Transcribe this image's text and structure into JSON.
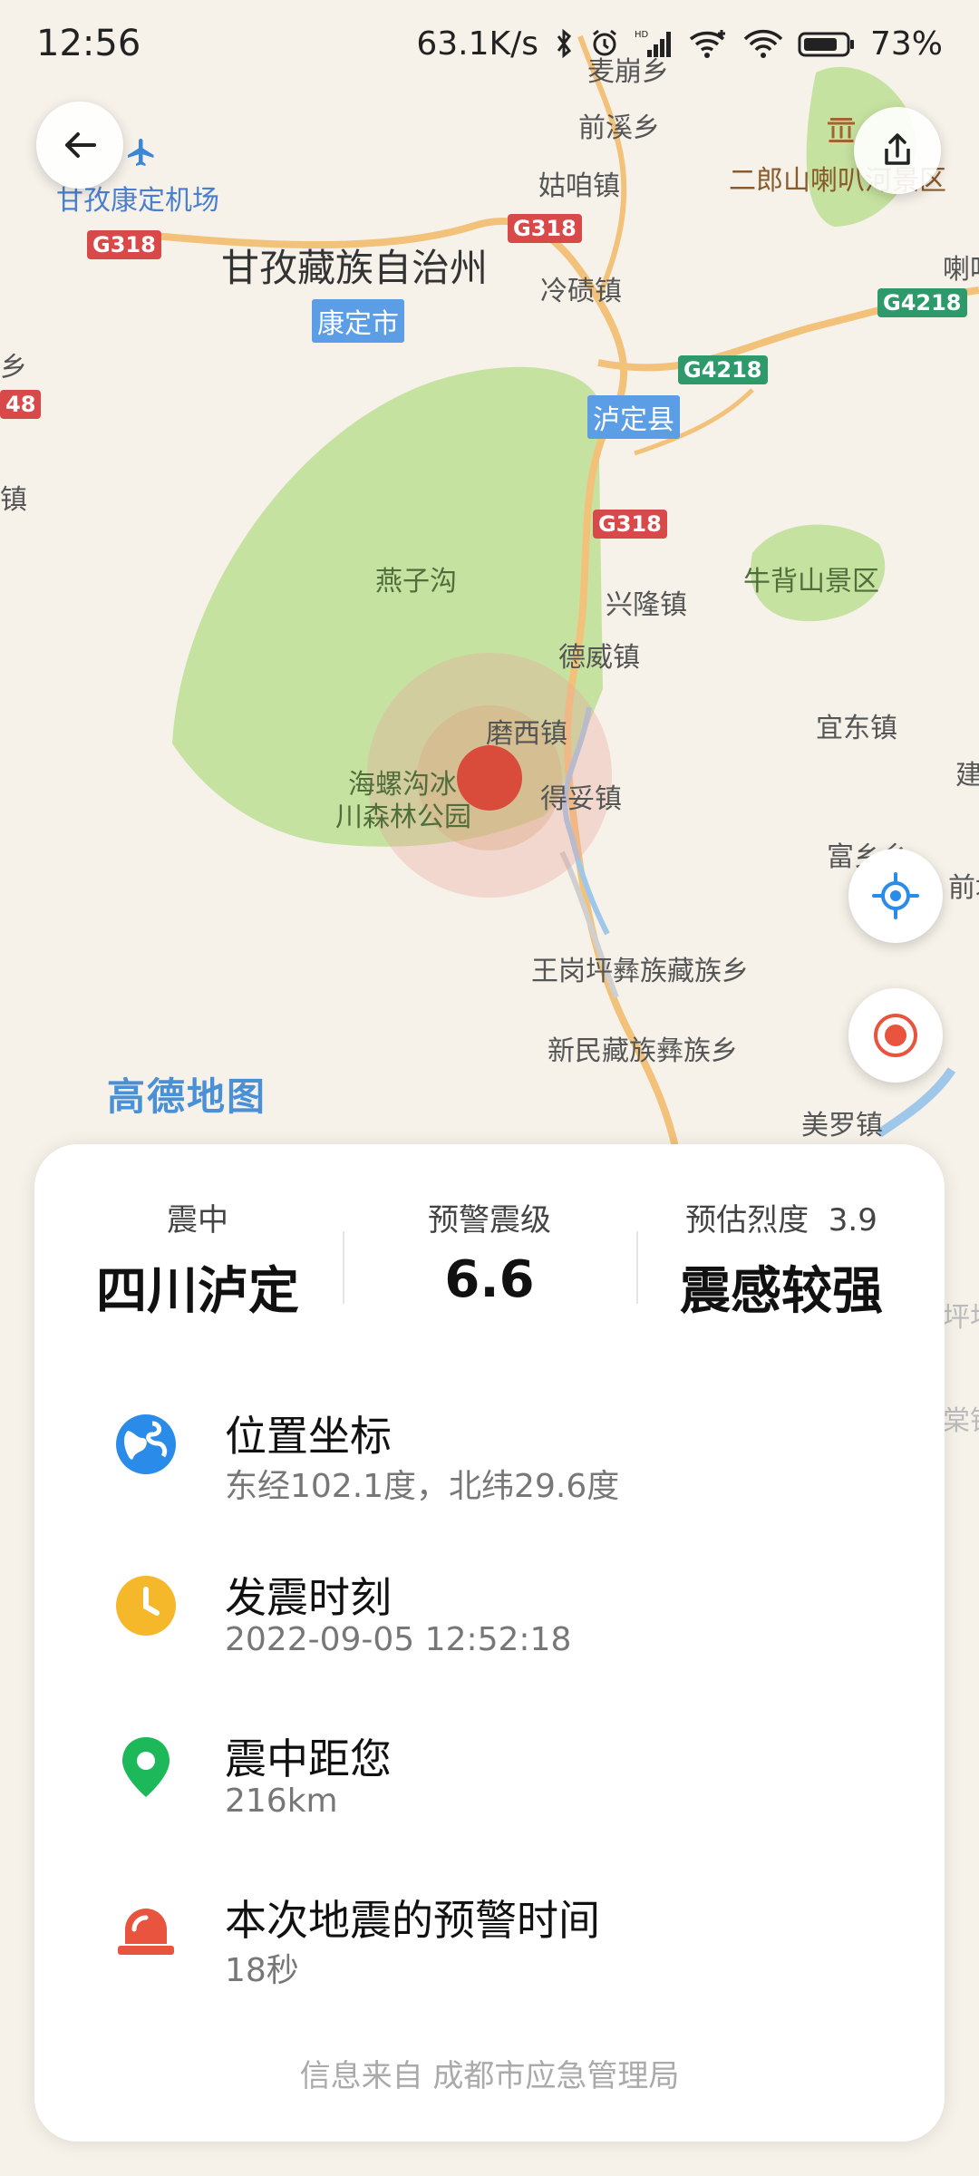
{
  "status_bar": {
    "time": "12:56",
    "speed": "63.1K/s",
    "battery": "73%",
    "icons": [
      "bluetooth-icon",
      "alarm-icon",
      "hd-signal-icon",
      "wifi-plus-icon",
      "wifi-icon",
      "battery-icon"
    ]
  },
  "map": {
    "labels": {
      "airport": "甘孜康定机场",
      "prefecture": "甘孜藏族自治州",
      "kangding": "康定市",
      "luding_county": "泸定县",
      "yanzigou": "燕子沟",
      "hailuogou_line1": "海螺沟冰",
      "hailuogou_line2": "川森林公园",
      "moxi": "磨西镇",
      "dewei": "德威镇",
      "xinglong": "兴隆镇",
      "deto": "得妥镇",
      "yidong": "宜东镇",
      "fuxiang": "富乡乡",
      "wanggangping": "王岗坪彝族藏族乡",
      "xinmin": "新民藏族彝族乡",
      "meiluo": "美罗镇",
      "niubeishan": "牛背山景区",
      "erlangshan": "二郎山喇叭河景区",
      "guzan": "姑咱镇",
      "qianxi": "前溪乡",
      "lengqi": "冷碛镇",
      "maibeng": "麦崩乡",
      "labaxiang": "喇叭",
      "qian": "前域",
      "jian": "建",
      "xiang": "乡",
      "zhen": "镇",
      "ping": "坪坝",
      "tang": "棠镇"
    },
    "shields": {
      "g318_left": "G318",
      "g318_top": "G318",
      "g318_mid": "G318",
      "g4218_a": "G4218",
      "g4218_b": "G4218",
      "g48": "48"
    },
    "logo": "高德地图",
    "colors": {
      "land": "#f6f2ea",
      "park": "#c6e2a0",
      "road": "#f3c27a",
      "river": "#9fc7ea",
      "epicenter": "#d94b3a",
      "ring": "#e7a79a"
    }
  },
  "controls": {
    "back": "arrow-left-icon",
    "share": "share-icon",
    "locate": "locate-icon",
    "record": "record-icon"
  },
  "card": {
    "epicenter_label": "震中",
    "epicenter_value": "四川泸定",
    "magnitude_label": "预警震级",
    "magnitude_value": "6.6",
    "intensity_label": "预估烈度",
    "intensity_num": "3.9",
    "intensity_value": "震感较强",
    "rows": [
      {
        "title": "位置坐标",
        "value": "东经102.1度，北纬29.6度",
        "icon": "globe-icon",
        "color": "#2a8ce8"
      },
      {
        "title": "发震时刻",
        "value": "2022-09-05 12:52:18",
        "icon": "clock-icon",
        "color": "#f6b82b"
      },
      {
        "title": "震中距您",
        "value": "216km",
        "icon": "location-pin-icon",
        "color": "#1db85a"
      },
      {
        "title": "本次地震的预警时间",
        "value": "18秒",
        "icon": "alarm-light-icon",
        "color": "#e9543f"
      }
    ],
    "source": "信息来自 成都市应急管理局"
  }
}
